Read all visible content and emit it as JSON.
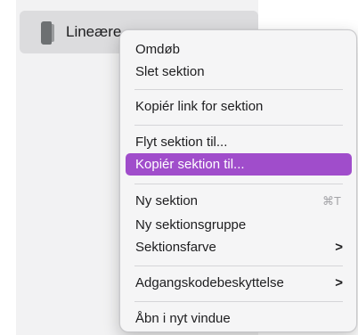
{
  "section": {
    "title": "Lineære"
  },
  "context_menu": {
    "items": [
      {
        "label": "Omdøb"
      },
      {
        "label": "Slet sektion"
      },
      {
        "label": "Kopiér link for sektion"
      },
      {
        "label": "Flyt sektion til..."
      },
      {
        "label": "Kopiér sektion til...",
        "highlighted": true
      },
      {
        "label": "Ny sektion",
        "shortcut": "⌘T"
      },
      {
        "label": "Ny sektionsgruppe"
      },
      {
        "label": "Sektionsfarve",
        "submenu": true
      },
      {
        "label": "Adgangskodebeskyttelse",
        "submenu": true
      },
      {
        "label": "Åbn i nyt vindue"
      }
    ],
    "chevron": ">",
    "highlight_color": "#a04dcb"
  }
}
